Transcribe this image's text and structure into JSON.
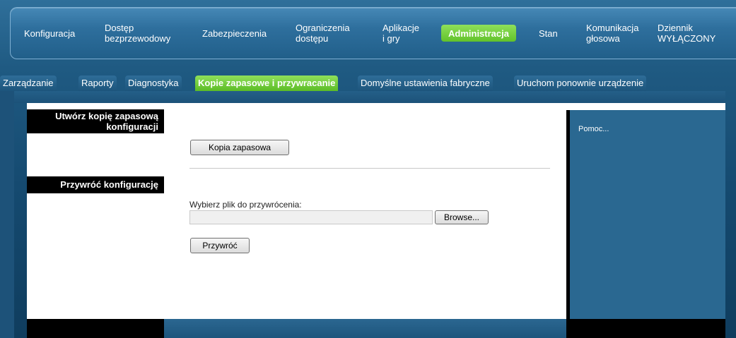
{
  "topnav": {
    "items": [
      {
        "label": "Konfiguracja"
      },
      {
        "label": "Dostęp\nbezprzewodowy"
      },
      {
        "label": "Zabezpieczenia"
      },
      {
        "label": "Ograniczenia\ndostępu"
      },
      {
        "label": "Aplikacje\ni gry"
      },
      {
        "label": "Administracja",
        "active": true
      },
      {
        "label": "Stan"
      },
      {
        "label": "Komunikacja\ngłosowa"
      },
      {
        "label": "Dziennik\nWYŁĄCZONY"
      }
    ]
  },
  "subtabs": [
    {
      "label": "Zarządzanie"
    },
    {
      "label": "Raporty"
    },
    {
      "label": "Diagnostyka"
    },
    {
      "label": "Kopie zapasowe i przywracanie",
      "active": true
    },
    {
      "label": "Domyślne ustawienia fabryczne"
    },
    {
      "label": "Uruchom ponownie urządzenie"
    }
  ],
  "sections": {
    "backup_heading": "Utwórz kopię zapasową\nkonfiguracji",
    "restore_heading": "Przywróć konfigurację"
  },
  "backup": {
    "button_label": "Kopia zapasowa"
  },
  "restore": {
    "file_label": "Wybierz plik do przywrócenia:",
    "file_value": "",
    "browse_label": "Browse...",
    "restore_button_label": "Przywróć"
  },
  "help": {
    "label": "Pomoc..."
  },
  "colors": {
    "accent_active": "#62c22a",
    "nav_blue": "#2e6f9d"
  }
}
